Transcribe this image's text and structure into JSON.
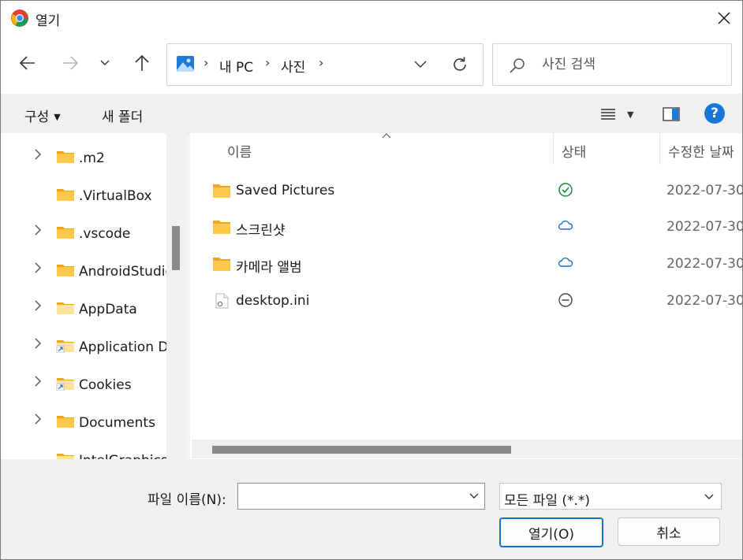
{
  "window": {
    "title": "열기"
  },
  "address": {
    "crumbs": [
      "내 PC",
      "사진"
    ]
  },
  "search": {
    "placeholder": "사진 검색"
  },
  "commands": {
    "organize": "구성",
    "new_folder": "새 폴더"
  },
  "tree": [
    {
      "label": ".m2",
      "expandable": true,
      "shortcut": false
    },
    {
      "label": ".VirtualBox",
      "expandable": false,
      "shortcut": false
    },
    {
      "label": ".vscode",
      "expandable": true,
      "shortcut": false
    },
    {
      "label": "AndroidStudio",
      "expandable": true,
      "shortcut": false
    },
    {
      "label": "AppData",
      "expandable": true,
      "shortcut": false
    },
    {
      "label": "Application D",
      "expandable": true,
      "shortcut": true
    },
    {
      "label": "Cookies",
      "expandable": true,
      "shortcut": true
    },
    {
      "label": "Documents",
      "expandable": true,
      "shortcut": false
    },
    {
      "label": "IntelGraphicsP",
      "expandable": false,
      "shortcut": false
    }
  ],
  "columns": {
    "name": "이름",
    "status": "상태",
    "modified": "수정한 날짜"
  },
  "files": [
    {
      "name": "Saved Pictures",
      "type": "folder",
      "status": "synced-check-icon",
      "date": "2022-07-30"
    },
    {
      "name": "스크린샷",
      "type": "folder",
      "status": "cloud-icon",
      "date": "2022-07-30"
    },
    {
      "name": "카메라 앨범",
      "type": "folder",
      "status": "cloud-icon",
      "date": "2022-07-30"
    },
    {
      "name": "desktop.ini",
      "type": "file",
      "status": "excluded-icon",
      "date": "2022-07-30"
    }
  ],
  "bottom": {
    "filename_label": "파일 이름(N):",
    "filename_value": "",
    "filetype": "모든 파일 (*.*)",
    "open": "열기(O)",
    "cancel": "취소"
  },
  "colors": {
    "accent": "#1672c9",
    "folder": "#f8c44b",
    "help": "#1877d8"
  }
}
